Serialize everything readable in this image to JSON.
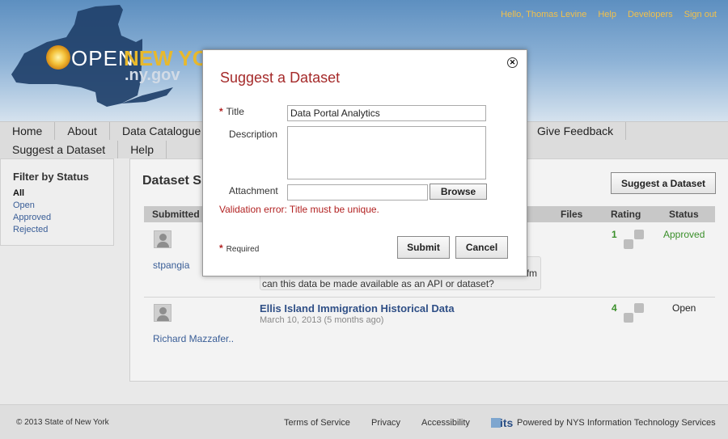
{
  "header": {
    "logo_open": "OPEN",
    "logo_ny": "NEW YO",
    "logo_gov": ".ny.gov",
    "links": [
      "Hello, Thomas Levine",
      "Help",
      "Developers",
      "Sign out"
    ]
  },
  "mainnav": {
    "row1": [
      "Home",
      "About",
      "Data Catalogue"
    ],
    "feedback": "Give Feedback",
    "row2": [
      "Suggest a Dataset",
      "Help"
    ]
  },
  "sidebar": {
    "heading": "Filter by Status",
    "filters": [
      "All",
      "Open",
      "Approved",
      "Rejected"
    ]
  },
  "content": {
    "heading": "Dataset S",
    "suggest_button": "Suggest a Dataset",
    "columns": [
      "Submitted b",
      "Files",
      "Rating",
      "Status"
    ],
    "rows": [
      {
        "user": "stpangia",
        "comment_tail": "fm",
        "comment": "can this data be made available as an API or dataset?",
        "rating": "1",
        "status": "Approved"
      },
      {
        "user": "Richard Mazzafer..",
        "title": "Ellis Island Immigration Historical Data",
        "date": "March 10, 2013 (5 months ago)",
        "rating": "4",
        "status": "Open"
      }
    ]
  },
  "footer": {
    "copyright": "© 2013 State of New York",
    "links": [
      "Terms of Service",
      "Privacy",
      "Accessibility"
    ],
    "its_logo": "its",
    "powered": "Powered by NYS Information Technology Services"
  },
  "modal": {
    "title": "Suggest a Dataset",
    "close_icon": "close-icon",
    "title_label": "Title",
    "title_value": "Data Portal Analytics",
    "description_label": "Description",
    "description_value": "",
    "attachment_label": "Attachment",
    "attachment_value": "",
    "browse_label": "Browse",
    "validation_error": "Validation error: Title must be unique.",
    "required_note": "Required",
    "required_star": "*",
    "submit_label": "Submit",
    "cancel_label": "Cancel"
  },
  "colors": {
    "accent_red": "#a52a2a",
    "link_blue": "#3a5e97",
    "gold": "#e8b92c",
    "approved_green": "#3a8f2a"
  }
}
